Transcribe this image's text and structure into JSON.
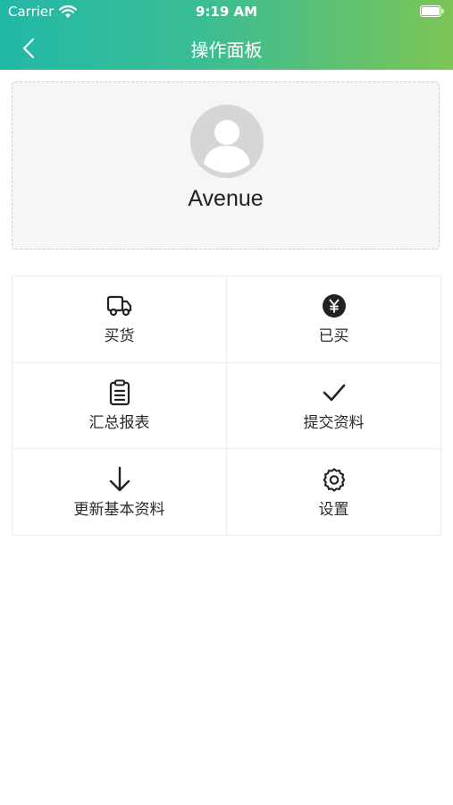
{
  "status_bar": {
    "carrier": "Carrier",
    "time": "9:19 AM"
  },
  "nav": {
    "title": "操作面板",
    "back_icon": "chevron-left-icon"
  },
  "profile": {
    "name": "Avenue",
    "avatar_icon": "user-avatar-icon"
  },
  "menu": {
    "items": [
      {
        "label": "买货",
        "icon": "truck-icon"
      },
      {
        "label": "已买",
        "icon": "yen-coin-icon"
      },
      {
        "label": "汇总报表",
        "icon": "clipboard-list-icon"
      },
      {
        "label": "提交资料",
        "icon": "check-icon"
      },
      {
        "label": "更新基本资料",
        "icon": "arrow-down-icon"
      },
      {
        "label": "设置",
        "icon": "gear-icon"
      }
    ]
  },
  "colors": {
    "header_gradient_start": "#22b8a6",
    "header_gradient_end": "#7cc556",
    "icon_color": "#222222"
  }
}
